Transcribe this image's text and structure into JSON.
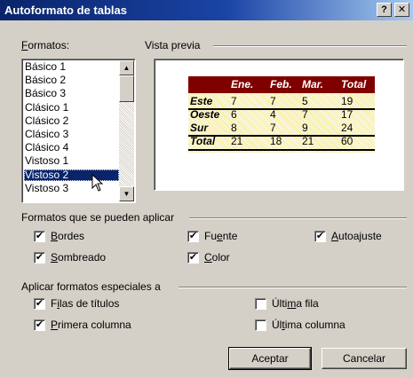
{
  "window": {
    "title": "Autoformato de tablas",
    "help_glyph": "?",
    "close_glyph": "✕"
  },
  "formats": {
    "label": "Formatos:",
    "items": [
      "Básico 1",
      "Básico 2",
      "Básico 3",
      "Clásico 1",
      "Clásico 2",
      "Clásico 3",
      "Clásico 4",
      "Vistoso 1",
      "Vistoso 2",
      "Vistoso 3"
    ],
    "selected": "Vistoso 2"
  },
  "preview": {
    "label": "Vista previa",
    "columns": [
      "",
      "Ene.",
      "Feb.",
      "Mar.",
      "Total"
    ],
    "rows": [
      [
        "Este",
        "7",
        "7",
        "5",
        "19"
      ],
      [
        "Oeste",
        "6",
        "4",
        "7",
        "17"
      ],
      [
        "Sur",
        "8",
        "7",
        "9",
        "24"
      ],
      [
        "Total",
        "21",
        "18",
        "21",
        "60"
      ]
    ],
    "header_color": "#800000",
    "body_color": "#f4e88e"
  },
  "apply": {
    "label": "Formatos que se pueden aplicar",
    "options": [
      {
        "label": "Bordes",
        "checked": true
      },
      {
        "label": "Sombreado",
        "checked": true
      },
      {
        "label": "Fuente",
        "checked": true
      },
      {
        "label": "Color",
        "checked": true
      },
      {
        "label": "Autoajuste",
        "checked": true
      }
    ]
  },
  "special": {
    "label": "Aplicar formatos especiales a",
    "options": [
      {
        "label": "Filas de títulos",
        "checked": true
      },
      {
        "label": "Primera columna",
        "checked": true
      },
      {
        "label": "Última fila",
        "checked": false
      },
      {
        "label": "Última columna",
        "checked": false
      }
    ]
  },
  "buttons": {
    "ok": "Aceptar",
    "cancel": "Cancelar"
  },
  "check_glyph": "✔"
}
